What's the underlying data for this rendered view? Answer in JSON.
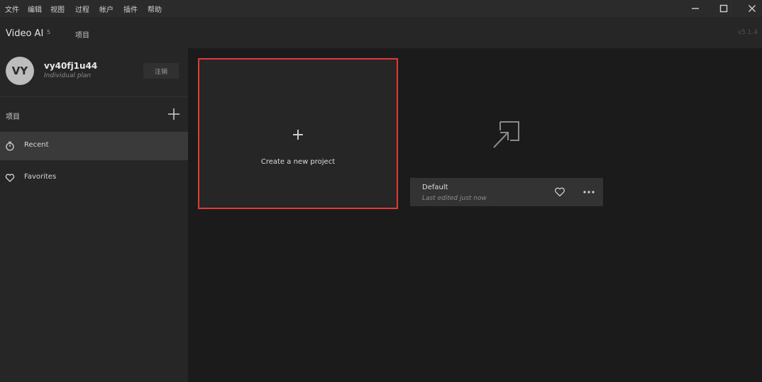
{
  "menu": [
    "文件",
    "编辑",
    "视图",
    "过程",
    "帐户",
    "插件",
    "帮助"
  ],
  "window_controls": {
    "minimize": "—",
    "maximize": "☐",
    "close": "✕"
  },
  "app": {
    "title": "Video AI",
    "badge": "5",
    "tab": "项目",
    "version": "v5.1.4"
  },
  "user": {
    "initials": "VY",
    "name": "vy40fj1u44",
    "plan": "Individual plan",
    "logout_label": "注销"
  },
  "sidebar": {
    "section_title": "项目",
    "items": [
      {
        "label": "Recent",
        "icon": "stopwatch-icon",
        "active": true
      },
      {
        "label": "Favorites",
        "icon": "heart-icon",
        "active": false
      }
    ]
  },
  "main": {
    "new_project": {
      "symbol": "+",
      "label": "Create a new project"
    },
    "projects": [
      {
        "name": "Default",
        "meta": "Last edited just now"
      }
    ]
  },
  "colors": {
    "highlight": "#e03a3a",
    "background": "#1b1b1b",
    "panel": "#262626"
  }
}
